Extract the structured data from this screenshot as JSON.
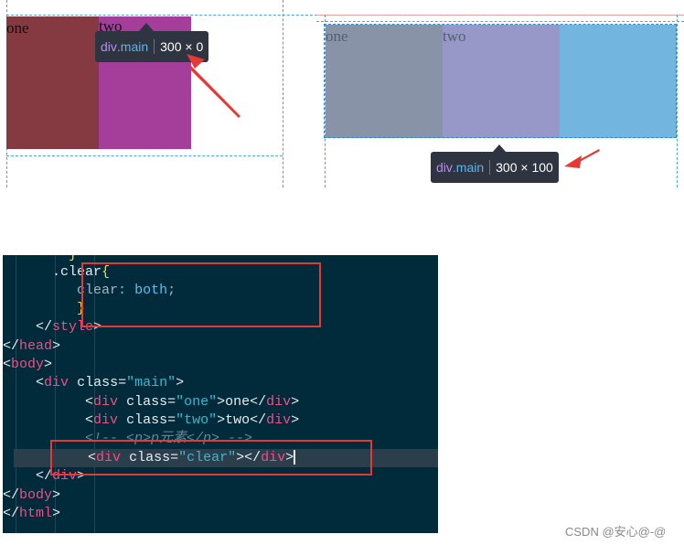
{
  "left_demo": {
    "one_label": "one",
    "two_label": "two",
    "tooltip": {
      "tag": "div",
      "class_name": ".main",
      "size": "300 × 0"
    }
  },
  "right_demo": {
    "one_label": "one",
    "two_label": "two",
    "tooltip": {
      "tag": "div",
      "class_name": ".main",
      "size": "300 × 100"
    }
  },
  "code": {
    "line_partial": "}",
    "clear_selector": ".clear",
    "clear_open": "{",
    "clear_prop": "clear",
    "clear_colon": ":",
    "clear_value": "both",
    "clear_semicolon": ";",
    "clear_close": "}",
    "style_close": "style",
    "head_close": "head",
    "body_open": "body",
    "div_main_tag": "div",
    "div_main_attr": "class",
    "div_main_value": "\"main\"",
    "one_tag": "div",
    "one_attr": "class",
    "one_value": "\"one\"",
    "one_text": "one",
    "two_tag": "div",
    "two_attr": "class",
    "two_value": "\"two\"",
    "two_text": "two",
    "comment": "<!-- <p>p元素</p> -->",
    "clear_div_tag": "div",
    "clear_div_attr": "class",
    "clear_div_value": "\"clear\"",
    "div_close": "div",
    "body_close": "body",
    "html_close": "html"
  },
  "watermark": "CSDN @安心@-@",
  "colors": {
    "red_annotation": "#e53935",
    "editor_bg": "#012a3a",
    "outline_blue": "#2a8ad3"
  }
}
